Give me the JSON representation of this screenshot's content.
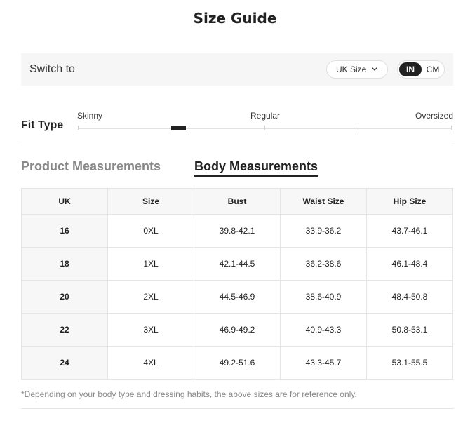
{
  "title": "Size Guide",
  "switch_bar": {
    "label": "Switch to",
    "size_select": "UK Size",
    "units": {
      "active": "IN",
      "inactive": "CM"
    }
  },
  "fit": {
    "label": "Fit Type",
    "options": [
      "Skinny",
      "Regular",
      "Oversized"
    ],
    "selected_level": 0.25
  },
  "tabs": {
    "product": "Product Measurements",
    "body": "Body Measurements",
    "active": "Body Measurements"
  },
  "table": {
    "headers": [
      "UK",
      "Size",
      "Bust",
      "Waist Size",
      "Hip Size"
    ],
    "rows": [
      [
        "16",
        "0XL",
        "39.8-42.1",
        "33.9-36.2",
        "43.7-46.1"
      ],
      [
        "18",
        "1XL",
        "42.1-44.5",
        "36.2-38.6",
        "46.1-48.4"
      ],
      [
        "20",
        "2XL",
        "44.5-46.9",
        "38.6-40.9",
        "48.4-50.8"
      ],
      [
        "22",
        "3XL",
        "46.9-49.2",
        "40.9-43.3",
        "50.8-53.1"
      ],
      [
        "24",
        "4XL",
        "49.2-51.6",
        "43.3-45.7",
        "53.1-55.5"
      ]
    ]
  },
  "footnote": "*Depending on your body type and dressing habits, the above sizes are for reference only.",
  "colors": {
    "accent": "#222222",
    "muted": "#888888",
    "panel": "#f6f6f6",
    "border": "#e5e5e5"
  }
}
